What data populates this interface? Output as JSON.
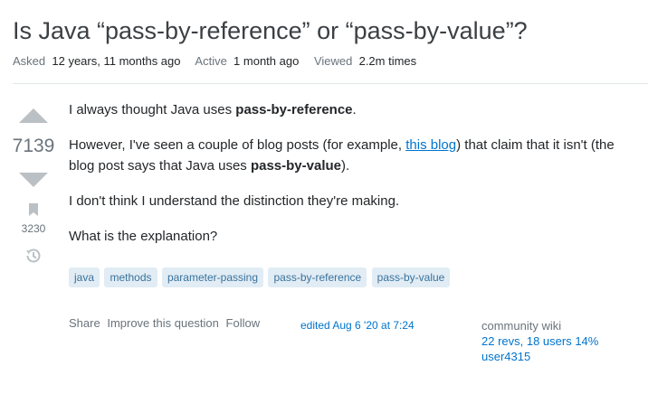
{
  "question": {
    "title": "Is Java “pass-by-reference” or “pass-by-value”?"
  },
  "meta": {
    "asked_label": "Asked",
    "asked_value": "12 years, 11 months ago",
    "active_label": "Active",
    "active_value": "1 month ago",
    "viewed_label": "Viewed",
    "viewed_value": "2.2m times"
  },
  "votes": {
    "score": "7139",
    "bookmarks": "3230"
  },
  "body": {
    "p1_pre": "I always thought Java uses ",
    "p1_bold": "pass-by-reference",
    "p1_post": ".",
    "p2_pre": "However, I've seen a couple of blog posts (for example, ",
    "p2_link": "this blog",
    "p2_mid": ") that claim that it isn't (the blog post says that Java uses ",
    "p2_bold": "pass-by-value",
    "p2_post": ").",
    "p3": "I don't think I understand the distinction they're making.",
    "p4": "What is the explanation?"
  },
  "tags": [
    "java",
    "methods",
    "parameter-passing",
    "pass-by-reference",
    "pass-by-value"
  ],
  "actions": {
    "share": "Share",
    "improve": "Improve this question",
    "follow": "Follow"
  },
  "edited": "edited Aug 6 '20 at 7:24",
  "owner": {
    "wiki_label": "community wiki",
    "revs": "22 revs, 18 users 14%",
    "user": "user4315"
  },
  "icons": {
    "vote_up": "triangle-up-icon",
    "vote_down": "triangle-down-icon",
    "bookmark": "bookmark-icon",
    "history": "history-icon"
  },
  "colors": {
    "link": "#0074cc",
    "tag_bg": "#e1ecf4",
    "tag_text": "#39739d",
    "vote_arrow": "#bbc0c4"
  }
}
